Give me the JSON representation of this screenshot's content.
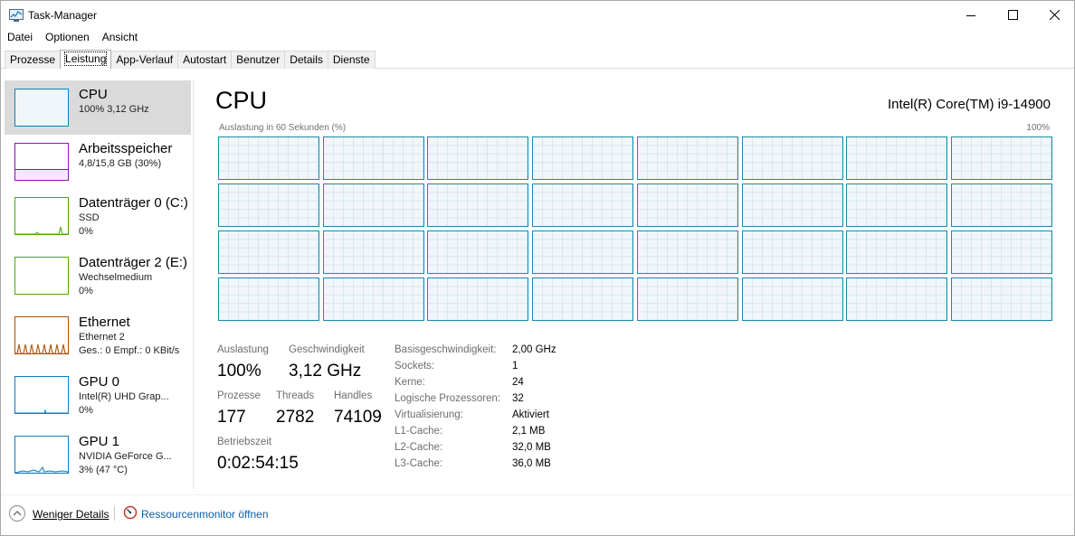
{
  "window": {
    "title": "Task-Manager",
    "icon": "task-manager-icon"
  },
  "menu": [
    "Datei",
    "Optionen",
    "Ansicht"
  ],
  "tabs": [
    "Prozesse",
    "Leistung",
    "App-Verlauf",
    "Autostart",
    "Benutzer",
    "Details",
    "Dienste"
  ],
  "active_tab": "Leistung",
  "sidebar": {
    "items": [
      {
        "title": "CPU",
        "line1": "100% 3,12 GHz",
        "line2": "",
        "color": "#117dbb"
      },
      {
        "title": "Arbeitsspeicher",
        "line1": "4,8/15,8 GB (30%)",
        "line2": "",
        "color": "#8b12ae"
      },
      {
        "title": "Datenträger 0 (C:)",
        "line1": "SSD",
        "line2": "0%",
        "color": "#4da60c"
      },
      {
        "title": "Datenträger 2 (E:)",
        "line1": "Wechselmedium",
        "line2": "0%",
        "color": "#4da60c"
      },
      {
        "title": "Ethernet",
        "line1": "Ethernet 2",
        "line2": "Ges.: 0 Empf.: 0 KBit/s",
        "color": "#a74f01"
      },
      {
        "title": "GPU 0",
        "line1": "Intel(R) UHD Grap...",
        "line2": "0%",
        "color": "#117dbb"
      },
      {
        "title": "GPU 1",
        "line1": "NVIDIA GeForce G...",
        "line2": "3% (47 °C)",
        "color": "#117dbb"
      }
    ]
  },
  "main": {
    "heading": "CPU",
    "model": "Intel(R) Core(TM) i9-14900",
    "graph_label": "Auslastung in 60 Sekunden (%)",
    "graph_max": "100%",
    "logical_processor_graphs": 32,
    "stats": {
      "utilization_label": "Auslastung",
      "utilization_value": "100%",
      "speed_label": "Geschwindigkeit",
      "speed_value": "3,12 GHz",
      "processes_label": "Prozesse",
      "processes_value": "177",
      "threads_label": "Threads",
      "threads_value": "2782",
      "handles_label": "Handles",
      "handles_value": "74109",
      "uptime_label": "Betriebszeit",
      "uptime_value": "0:02:54:15"
    },
    "specs": [
      {
        "label": "Basisgeschwindigkeit:",
        "value": "2,00 GHz"
      },
      {
        "label": "Sockets:",
        "value": "1"
      },
      {
        "label": "Kerne:",
        "value": "24"
      },
      {
        "label": "Logische Prozessoren:",
        "value": "32"
      },
      {
        "label": "Virtualisierung:",
        "value": "Aktiviert"
      },
      {
        "label": "L1-Cache:",
        "value": "2,1 MB"
      },
      {
        "label": "L2-Cache:",
        "value": "32,0 MB"
      },
      {
        "label": "L3-Cache:",
        "value": "36,0 MB"
      }
    ]
  },
  "footer": {
    "less_details": "Weniger Details",
    "resource_monitor": "Ressourcenmonitor öffnen"
  }
}
